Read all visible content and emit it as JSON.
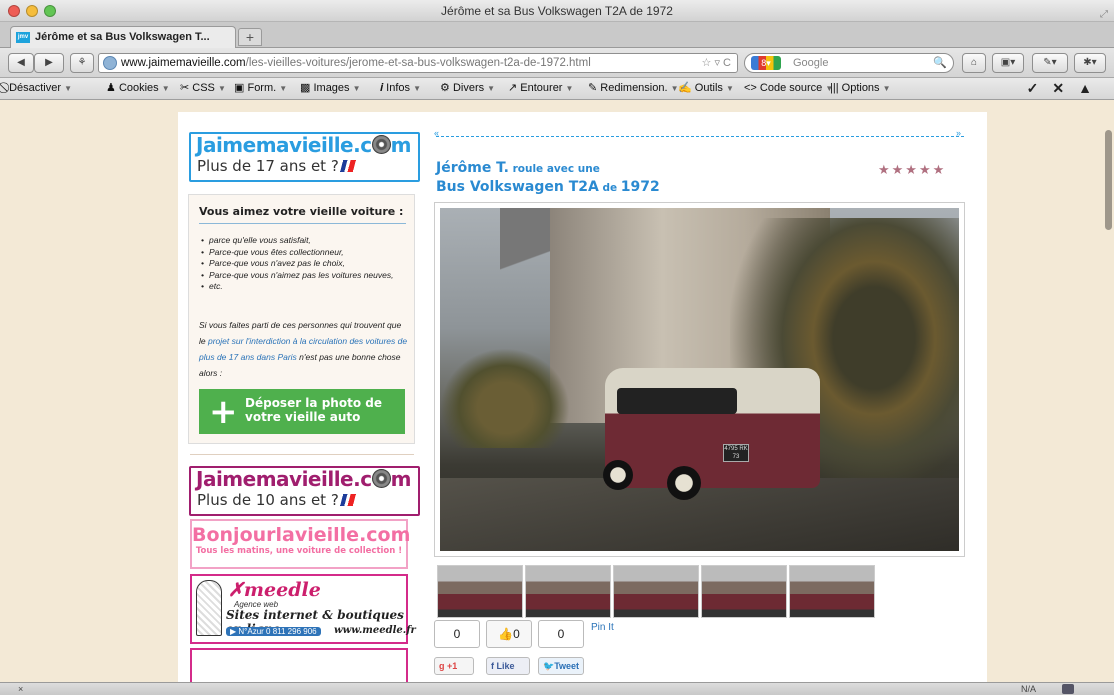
{
  "window": {
    "title": "Jérôme et sa Bus Volkswagen T2A de 1972"
  },
  "tabs": [
    {
      "label": "Jérôme et sa Bus Volkswagen T...",
      "favicon": "jmv"
    }
  ],
  "nav": {
    "url_domain": "www.jaimemavieille.com",
    "url_path": "/les-vieilles-voitures/jerome-et-sa-bus-volkswagen-t2a-de-1972.html",
    "search_engine": "Google",
    "back_icon": "◀",
    "forward_icon": "▶",
    "reload_icon": "C",
    "home_icon": "⌂"
  },
  "devbar": {
    "items": [
      "Désactiver",
      "Cookies",
      "CSS",
      "Form.",
      "Images",
      "Infos",
      "Divers",
      "Entourer",
      "Redimension.",
      "Outils",
      "Code source",
      "Options"
    ],
    "icons": [
      "⃠",
      "♟",
      "✂",
      "▣",
      "▩",
      "𝒊",
      "⚙",
      "↗",
      "✎",
      "✍",
      "<>",
      "|||"
    ]
  },
  "sidebar": {
    "logo1": {
      "main": "Jaimemavieille.c",
      "main_end": "m",
      "sub": "Plus de 17 ans et ?",
      "color": "#2a9de0"
    },
    "promo": {
      "title": "Vous aimez votre vieille voiture :",
      "items": [
        "parce qu'elle vous satisfait,",
        "Parce-que vous êtes collectionneur,",
        "Parce-que vous n'avez pas le choix,",
        "Parce-que vous n'aimez pas les voitures neuves,",
        "etc."
      ],
      "text_before": "Si vous faites parti de ces personnes qui trouvent que le ",
      "link": "projet sur l'interdiction à la circulation des voitures de plus de 17 ans dans Paris",
      "text_after": " n'est pas une bonne chose alors :",
      "button": "Déposer la photo de votre vieille auto",
      "button_icon": "+"
    },
    "logo2": {
      "main": "Jaimemavieille.c",
      "main_end": "m",
      "sub": "Plus de 10 ans et ?",
      "color": "#a01e6e"
    },
    "bonjour": {
      "main": "Bonjourlavieille.com",
      "sub": "Tous les matins, une voiture de collection !"
    },
    "meedle": {
      "logo": "meedle",
      "agence": "Agence web",
      "sites": "Sites internet & boutiques en ligne",
      "phone": "▶ N°Azur 0 811 296 906",
      "web": "www.meedle.fr"
    }
  },
  "article": {
    "dots_left": "«",
    "dots_right": "»",
    "owner": "Jérôme T.",
    "rides": " roule avec une",
    "car": "Bus Volkswagen T2A",
    "de": " de ",
    "year": "1972",
    "rating": 5,
    "rating_stars": "★★★★★",
    "plate": "4795 RK 73",
    "thumbnails": 5,
    "social": {
      "gplus_count": "0",
      "like_count": "0",
      "tweet_count": "0",
      "gplus": "+1",
      "like": "Like",
      "tweet": "Tweet",
      "pinit": "Pin It"
    }
  },
  "status": {
    "left": "×",
    "right": "N/A"
  }
}
